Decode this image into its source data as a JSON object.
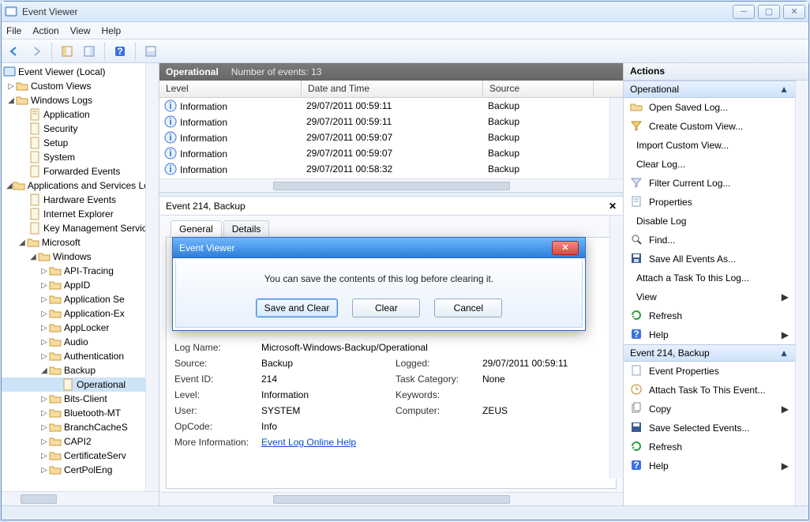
{
  "window": {
    "title": "Event Viewer"
  },
  "menus": [
    "File",
    "Action",
    "View",
    "Help"
  ],
  "tree": {
    "root": "Event Viewer (Local)",
    "custom_views": "Custom Views",
    "windows_logs": "Windows Logs",
    "wl": {
      "application": "Application",
      "security": "Security",
      "setup": "Setup",
      "system": "System",
      "forwarded": "Forwarded Events"
    },
    "apps_svcs": "Applications and Services Logs",
    "as": {
      "hardware": "Hardware Events",
      "ie": "Internet Explorer",
      "kms": "Key Management Service",
      "microsoft": "Microsoft",
      "windows": "Windows",
      "nodes": {
        "api_tracing": "API-Tracing",
        "appid": "AppID",
        "app_se": "Application Se",
        "app_ex": "Application-Ex",
        "applocker": "AppLocker",
        "audio": "Audio",
        "auth": "Authentication",
        "backup": "Backup",
        "operational": "Operational",
        "bits": "Bits-Client",
        "bt": "Bluetooth-MT",
        "branch": "BranchCacheS",
        "capi2": "CAPI2",
        "certserv": "CertificateServ",
        "certpol": "CertPolEng"
      }
    }
  },
  "ops": {
    "title": "Operational",
    "count_label": "Number of events: 13",
    "cols": {
      "level": "Level",
      "date": "Date and Time",
      "source": "Source"
    },
    "rows": [
      {
        "level": "Information",
        "date": "29/07/2011 00:59:11",
        "source": "Backup"
      },
      {
        "level": "Information",
        "date": "29/07/2011 00:59:11",
        "source": "Backup"
      },
      {
        "level": "Information",
        "date": "29/07/2011 00:59:07",
        "source": "Backup"
      },
      {
        "level": "Information",
        "date": "29/07/2011 00:59:07",
        "source": "Backup"
      },
      {
        "level": "Information",
        "date": "29/07/2011 00:58:32",
        "source": "Backup"
      }
    ]
  },
  "detail": {
    "header": "Event 214, Backup",
    "tabs": {
      "general": "General",
      "details": "Details"
    },
    "log_name_k": "Log Name:",
    "log_name_v": "Microsoft-Windows-Backup/Operational",
    "source_k": "Source:",
    "source_v": "Backup",
    "logged_k": "Logged:",
    "logged_v": "29/07/2011 00:59:11",
    "eventid_k": "Event ID:",
    "eventid_v": "214",
    "taskcat_k": "Task Category:",
    "taskcat_v": "None",
    "level_k": "Level:",
    "level_v": "Information",
    "keywords_k": "Keywords:",
    "keywords_v": "",
    "user_k": "User:",
    "user_v": "SYSTEM",
    "computer_k": "Computer:",
    "computer_v": "ZEUS",
    "opcode_k": "OpCode:",
    "opcode_v": "Info",
    "moreinfo_k": "More Information:",
    "moreinfo_v": "Event Log Online Help"
  },
  "actions": {
    "title": "Actions",
    "section1": "Operational",
    "items1": {
      "open_saved": "Open Saved Log...",
      "create_custom": "Create Custom View...",
      "import_custom": "Import Custom View...",
      "clear_log": "Clear Log...",
      "filter": "Filter Current Log...",
      "properties": "Properties",
      "disable": "Disable Log",
      "find": "Find...",
      "save_all": "Save All Events As...",
      "attach": "Attach a Task To this Log...",
      "view": "View",
      "refresh": "Refresh",
      "help": "Help"
    },
    "section2": "Event 214, Backup",
    "items2": {
      "event_props": "Event Properties",
      "attach_event": "Attach Task To This Event...",
      "copy": "Copy",
      "save_selected": "Save Selected Events...",
      "refresh": "Refresh",
      "help": "Help"
    }
  },
  "dialog": {
    "title": "Event Viewer",
    "message": "You can save the contents of this log before clearing it.",
    "save_clear": "Save and Clear",
    "clear": "Clear",
    "cancel": "Cancel"
  }
}
